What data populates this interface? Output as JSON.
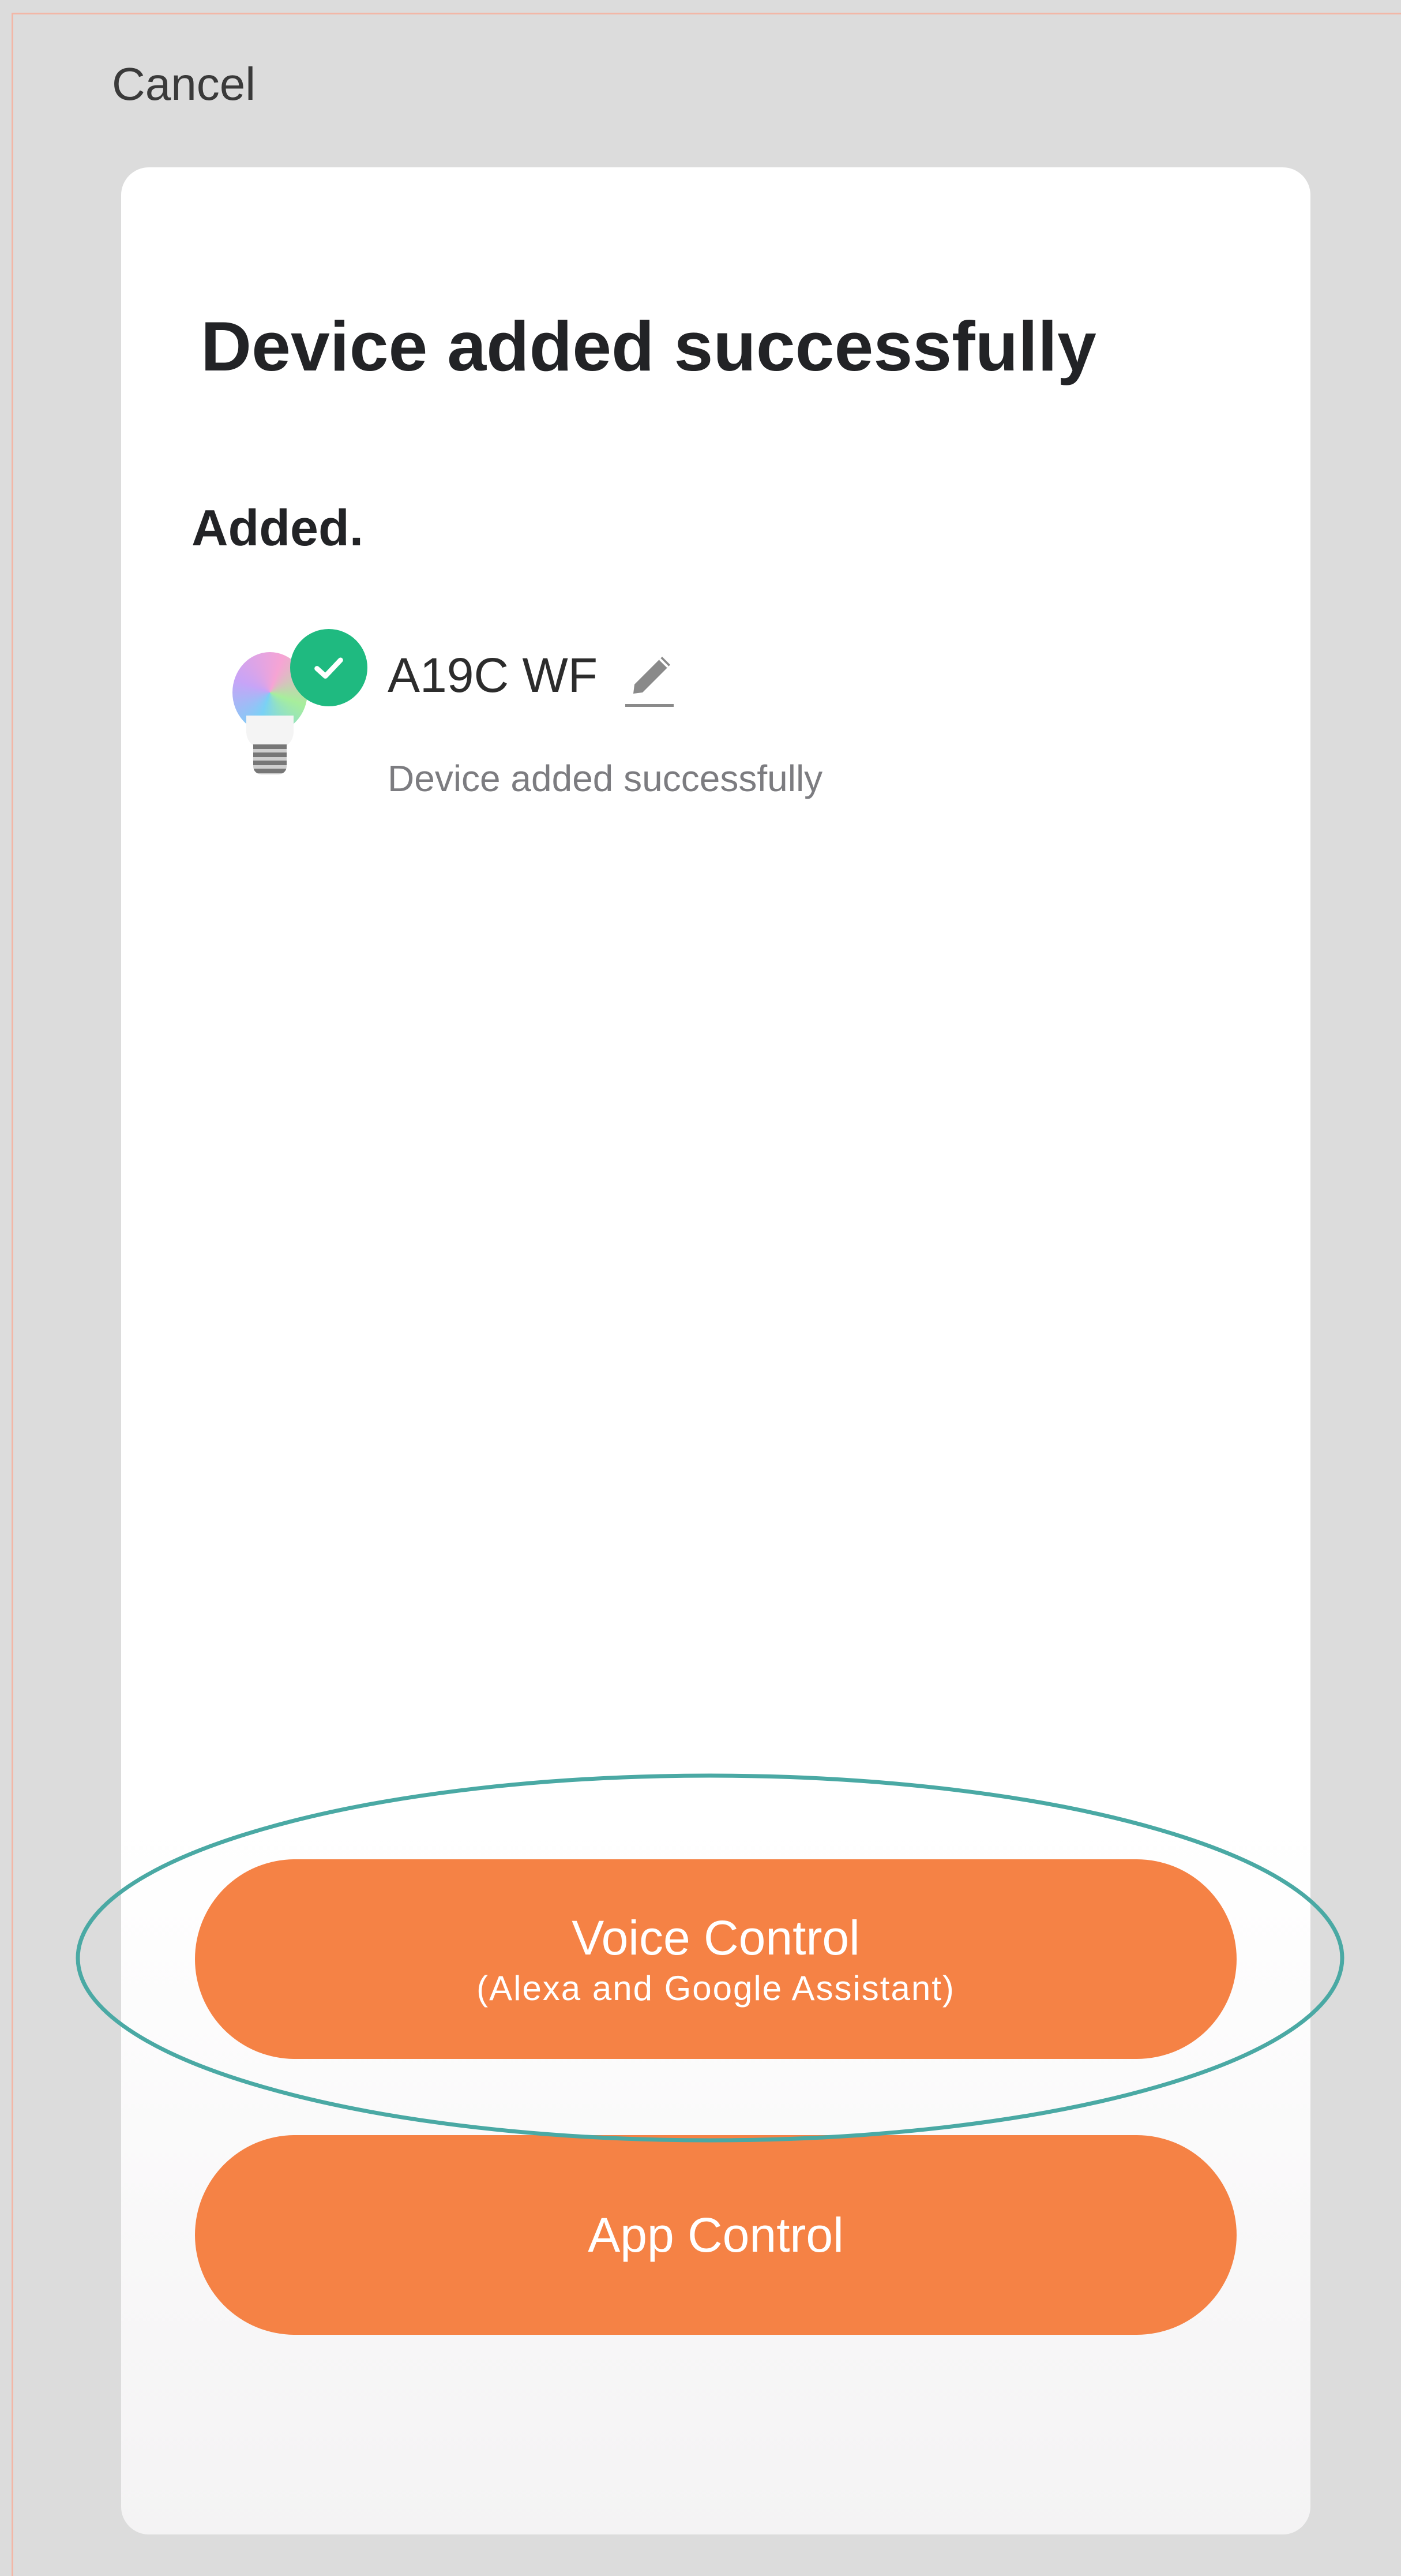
{
  "header": {
    "cancel_label": "Cancel"
  },
  "card": {
    "title": "Device added successfully",
    "section_label": "Added.",
    "device": {
      "name": "A19C WF",
      "status": "Device added successfully",
      "icon": "rgb-bulb-icon",
      "badge_icon": "check-icon"
    }
  },
  "actions": {
    "voice_label": "Voice Control",
    "voice_sublabel": "(Alexa and Google Assistant)",
    "app_label": "App Control"
  },
  "colors": {
    "background": "#dcdcdc",
    "card": "#ffffff",
    "button": "#f58245",
    "success": "#1fba80",
    "annotation_ellipse": "#4aa9a4"
  }
}
